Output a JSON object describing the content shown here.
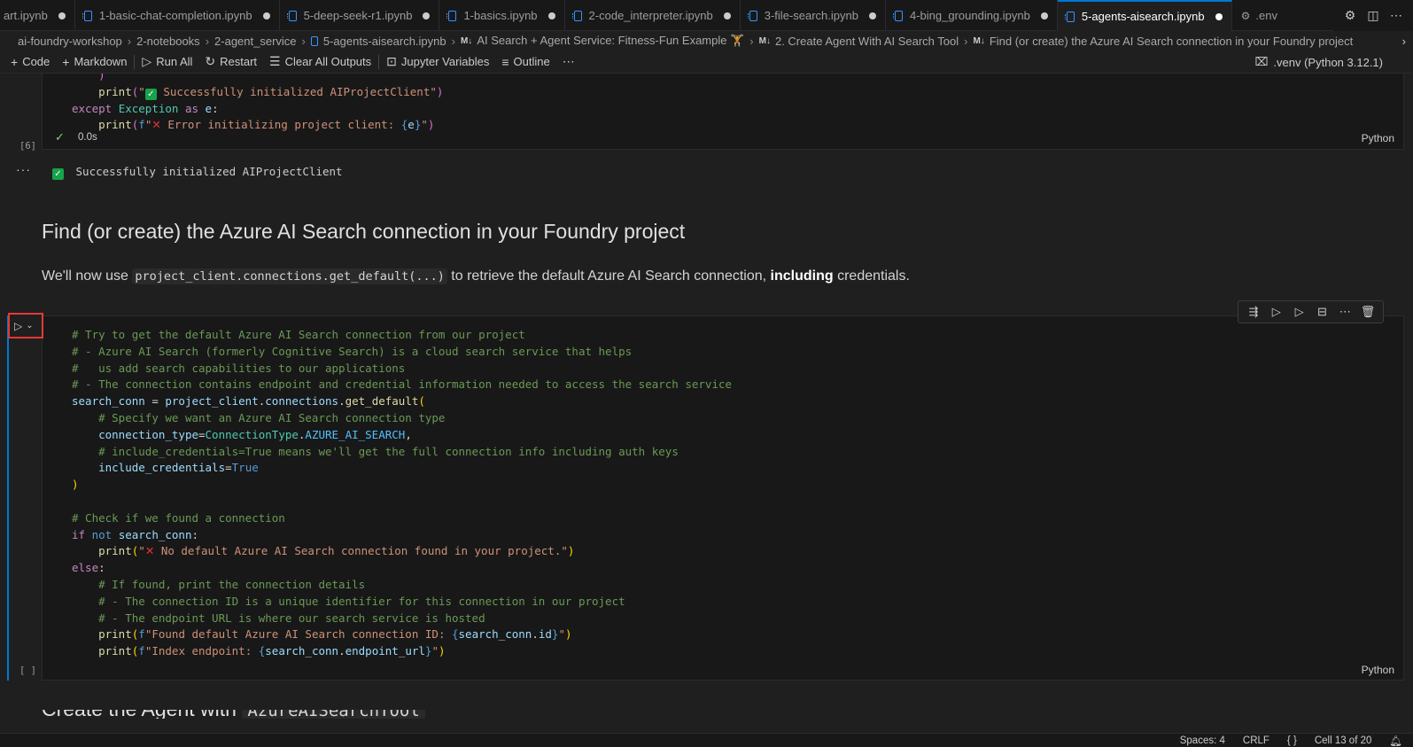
{
  "tabs": [
    {
      "label": "art.ipynb",
      "active": false
    },
    {
      "label": "1-basic-chat-completion.ipynb",
      "active": false
    },
    {
      "label": "5-deep-seek-r1.ipynb",
      "active": false
    },
    {
      "label": "1-basics.ipynb",
      "active": false
    },
    {
      "label": "2-code_interpreter.ipynb",
      "active": false
    },
    {
      "label": "3-file-search.ipynb",
      "active": false
    },
    {
      "label": "4-bing_grounding.ipynb",
      "active": false
    },
    {
      "label": "5-agents-aisearch.ipynb",
      "active": true
    },
    {
      "label": ".env",
      "active": false
    }
  ],
  "breadcrumb": {
    "root": "ai-foundry-workshop",
    "folder1": "2-notebooks",
    "folder2": "2-agent_service",
    "file": "5-agents-aisearch.ipynb",
    "md_tag": "M↓",
    "section1": "AI Search + Agent Service: Fitness-Fun Example 🏋",
    "section2": "2. Create Agent With AI Search Tool",
    "section3": "Find (or create) the Azure AI Search connection in your Foundry project"
  },
  "toolbar": {
    "code": "Code",
    "markdown": "Markdown",
    "run_all": "Run All",
    "restart": "Restart",
    "clear_outputs": "Clear All Outputs",
    "variables": "Jupyter Variables",
    "outline": "Outline",
    "kernel": ".venv (Python 3.12.1)"
  },
  "prev_cell": {
    "exec_count": "[6]",
    "time": "0.0s",
    "lang": "Python",
    "output": "Successfully initialized AIProjectClient"
  },
  "markdown": {
    "heading": "Find (or create) the Azure AI Search connection in your Foundry project",
    "para_pre": "We'll now use ",
    "para_code": "project_client.connections.get_default(...)",
    "para_mid": " to retrieve the default Azure AI Search connection, ",
    "para_bold": "including",
    "para_post": " credentials."
  },
  "active_cell": {
    "exec_count": "[ ]",
    "lang": "Python"
  },
  "next_heading": {
    "text": "Create the Agent with",
    "code": "AzureAISearchTool"
  },
  "statusbar": {
    "spaces": "Spaces: 4",
    "eol": "CRLF",
    "braces": "{ }",
    "cell": "Cell 13 of 20"
  }
}
